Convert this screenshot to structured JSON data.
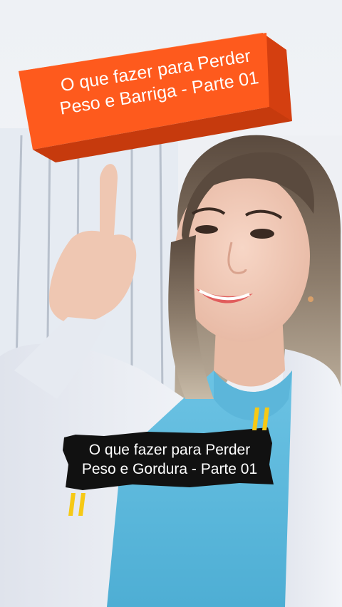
{
  "top_banner": {
    "line1": "O que fazer para Perder",
    "line2": "Peso e Barriga - Parte 01",
    "color": "#fe5a1d"
  },
  "caption": {
    "line1": "O que fazer para Perder",
    "line2": "Peso e Gordura - Parte 01"
  },
  "quote_color": "#f6c915"
}
